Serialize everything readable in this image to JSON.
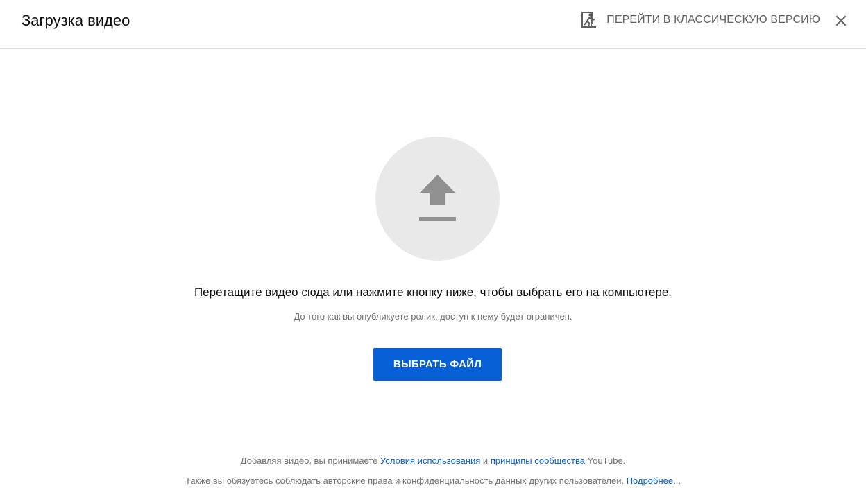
{
  "header": {
    "title": "Загрузка видео",
    "classic_link_label": "ПЕРЕЙТИ В КЛАССИЧЕСКУЮ ВЕРСИЮ",
    "classic_icon": "exit-to-app-icon",
    "close_icon": "close-icon"
  },
  "main": {
    "upload_icon": "upload-icon",
    "drop_text": "Перетащите видео сюда или нажмите кнопку ниже, чтобы выбрать его на компьютере.",
    "privacy_note": "До того как вы опубликуете ролик, доступ к нему будет ограничен.",
    "select_button": "ВЫБРАТЬ ФАЙЛ"
  },
  "footer": {
    "line1_prefix": "Добавляя видео, вы принимаете ",
    "terms_link": "Условия использования",
    "line1_and": " и ",
    "guidelines_link": "принципы сообщества",
    "line1_suffix": " YouTube.",
    "line2_prefix": "Также вы обязуетесь соблюдать авторские права и конфиденциальность данных других пользователей. ",
    "learn_more_link": "Подробнее..."
  },
  "colors": {
    "accent": "#065fd4",
    "icon_gray": "#909090",
    "circle_bg": "#e9e9e9",
    "secondary_text": "#717171"
  }
}
